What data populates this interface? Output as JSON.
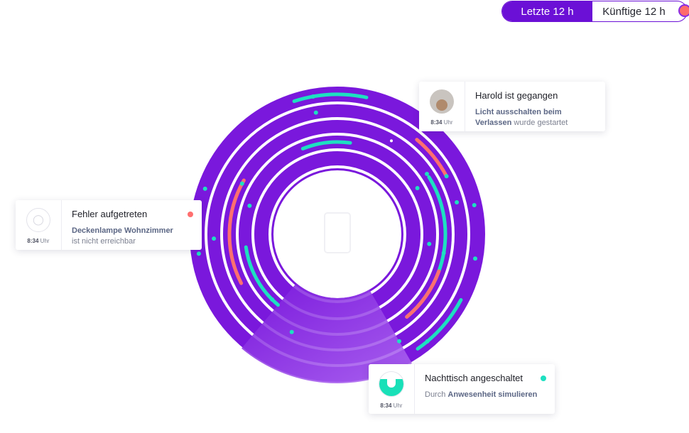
{
  "toggle": {
    "left_label": "Letzte 12 h",
    "right_label": "Künftige 12 h"
  },
  "colors": {
    "purple": "#7a18dc",
    "teal": "#1de0c1",
    "coral": "#ff6f6f",
    "card_shadow": "#282850"
  },
  "cards": {
    "harold": {
      "title": "Harold ist gegangen",
      "desc_highlight": "Licht ausschalten beim Verlassen",
      "desc_rest": " wurde gestartet",
      "time": "8:34",
      "time_unit": "Uhr"
    },
    "error": {
      "title": "Fehler aufgetreten",
      "desc_highlight": "Deckenlampe Wohnzimmer",
      "desc_rest": "ist nicht erreichbar",
      "time": "8:34",
      "time_unit": "Uhr",
      "status_color": "#ff6f6f"
    },
    "nacht": {
      "title": "Nachttisch angeschaltet",
      "desc_prefix": "Durch ",
      "desc_highlight": "Anwesenheit simulieren",
      "time": "8:34",
      "time_unit": "Uhr",
      "status_color": "#1de0c1"
    }
  }
}
